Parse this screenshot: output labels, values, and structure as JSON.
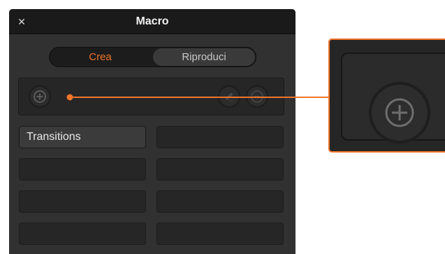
{
  "window": {
    "title": "Macro"
  },
  "icons": {
    "close": "close-icon",
    "add": "plus-circle-icon",
    "edit": "pencil-icon",
    "delete": "minus-circle-icon"
  },
  "tabs": {
    "create": "Crea",
    "play": "Riproduci",
    "selected": "Crea"
  },
  "macros": {
    "slots": [
      "Transitions",
      "",
      "",
      "",
      "",
      "",
      "",
      ""
    ]
  },
  "colors": {
    "accent": "#f0742a",
    "panel": "#313131",
    "titlebar": "#1a1a1a"
  }
}
